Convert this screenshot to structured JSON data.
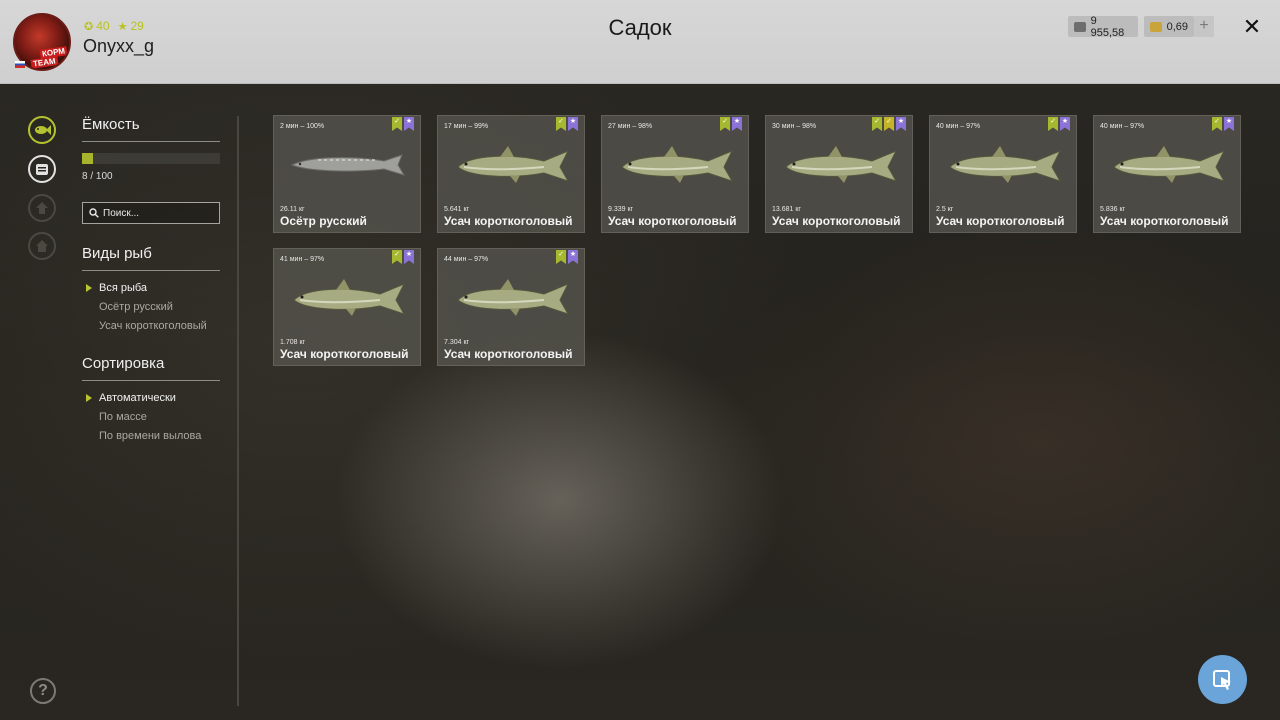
{
  "header": {
    "title": "Садок",
    "username": "Onyxx_g",
    "avatar_text_1": "КОРМ",
    "avatar_text_2": "TEAM",
    "stat_rating": "40",
    "stat_stars": "29",
    "silver": "9 955,58",
    "gold": "0,69",
    "plus": "+",
    "close": "✕"
  },
  "sidebar": {
    "capacity_title": "Ёмкость",
    "capacity_text": "8 / 100",
    "capacity_fraction": 0.08,
    "search_placeholder": "Поиск...",
    "species_title": "Виды рыб",
    "species": [
      "Вся рыба",
      "Осётр русский",
      "Усач короткоголовый"
    ],
    "sort_title": "Сортировка",
    "sort": [
      "Автоматически",
      "По массе",
      "По времени вылова"
    ],
    "help": "?"
  },
  "catches": [
    {
      "time": "2 мин – 100%",
      "weight": "26.11 кг",
      "name": "Осётр русский",
      "fish": "sturgeon",
      "badges": [
        "green",
        "purple"
      ]
    },
    {
      "time": "17 мин – 99%",
      "weight": "5.641 кг",
      "name": "Усач короткоголовый",
      "fish": "barbel",
      "badges": [
        "green",
        "purple"
      ]
    },
    {
      "time": "27 мин – 98%",
      "weight": "9.339 кг",
      "name": "Усач короткоголовый",
      "fish": "barbel",
      "badges": [
        "green",
        "purple"
      ]
    },
    {
      "time": "30 мин – 98%",
      "weight": "13.681 кг",
      "name": "Усач короткоголовый",
      "fish": "barbel",
      "badges": [
        "green",
        "yellow",
        "purple"
      ]
    },
    {
      "time": "40 мин – 97%",
      "weight": "2.5 кг",
      "name": "Усач короткоголовый",
      "fish": "barbel",
      "badges": [
        "green",
        "purple"
      ]
    },
    {
      "time": "40 мин – 97%",
      "weight": "5.836 кг",
      "name": "Усач короткоголовый",
      "fish": "barbel",
      "badges": [
        "green",
        "purple"
      ]
    },
    {
      "time": "41 мин – 97%",
      "weight": "1.708 кг",
      "name": "Усач короткоголовый",
      "fish": "barbel",
      "badges": [
        "green",
        "purple"
      ]
    },
    {
      "time": "44 мин – 97%",
      "weight": "7.304 кг",
      "name": "Усач короткоголовый",
      "fish": "barbel",
      "badges": [
        "green",
        "purple"
      ]
    }
  ],
  "colors": {
    "accent": "#b4c230",
    "header_bg": "#d4d4d4",
    "cursor_button": "#6aa4d8"
  }
}
